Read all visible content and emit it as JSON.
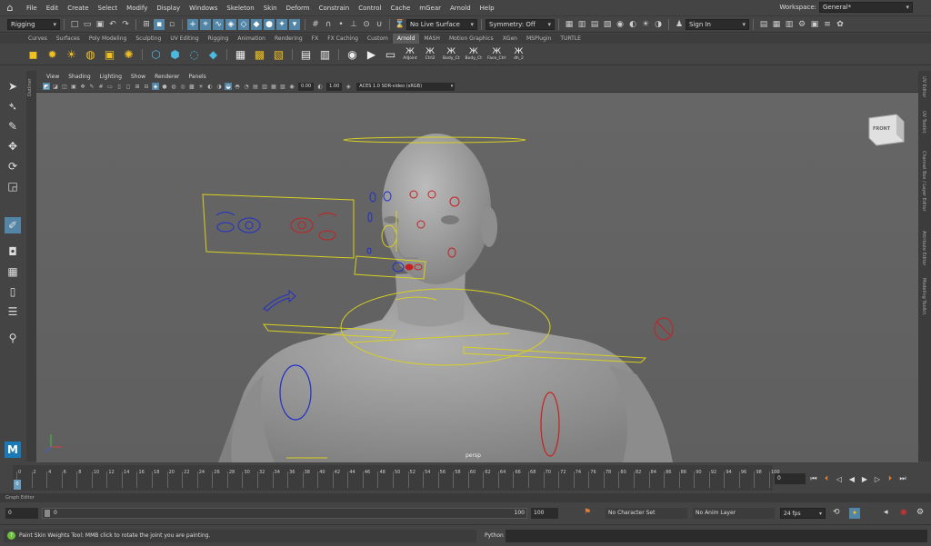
{
  "menubar": {
    "items": [
      "File",
      "Edit",
      "Create",
      "Select",
      "Modify",
      "Display",
      "Windows",
      "Skeleton",
      "Skin",
      "Deform",
      "Constrain",
      "Control",
      "Cache",
      "mGear",
      "Arnold",
      "Help"
    ],
    "workspace_label": "Workspace:",
    "workspace_value": "General*"
  },
  "statusline": {
    "menuset": "Rigging",
    "live_surface": "No Live Surface",
    "symmetry": "Symmetry: Off",
    "sign_in": "Sign In"
  },
  "shelf": {
    "tabs": [
      "Curves",
      "Surfaces",
      "Poly Modeling",
      "Sculpting",
      "UV Editing",
      "Rigging",
      "Animation",
      "Rendering",
      "FX",
      "FX Caching",
      "Custom",
      "Arnold",
      "MASH",
      "Motion Graphics",
      "XGen",
      "MSPlugin",
      "TURTLE"
    ],
    "active_tab": "Arnold",
    "text_buttons": [
      "AllJoint",
      "Ctrl2",
      "Body_Ct",
      "Body_Ct",
      "Face_Ctrl",
      "dh_2"
    ]
  },
  "panel": {
    "menus": [
      "View",
      "Shading",
      "Lighting",
      "Show",
      "Renderer",
      "Panels"
    ],
    "exposure": "0.00",
    "gamma": "1.00",
    "color_space": "ACES 1.0 SDR-video (sRGB)",
    "camera_label": "persp",
    "viewcube_label": "FRONT"
  },
  "side_labels": {
    "outliner": "Outliner",
    "right": [
      "UV Editor",
      "UV Toolkit",
      "Channel Box / Layer Editor",
      "Attribute Editor",
      "Modeling Toolkit"
    ]
  },
  "timeslider": {
    "ticks": [
      "0",
      "2",
      "4",
      "6",
      "8",
      "10",
      "12",
      "14",
      "16",
      "18",
      "20",
      "22",
      "24",
      "26",
      "28",
      "30",
      "32",
      "34",
      "36",
      "38",
      "40",
      "42",
      "44",
      "46",
      "48",
      "50",
      "52",
      "54",
      "56",
      "58",
      "60",
      "62",
      "64",
      "66",
      "68",
      "70",
      "72",
      "74",
      "76",
      "78",
      "80",
      "82",
      "84",
      "86",
      "88",
      "90",
      "92",
      "94",
      "96",
      "98",
      "100"
    ],
    "current_frame": "0",
    "current_frame_marker": "0"
  },
  "graph_editor_label": "Graph Editor",
  "range": {
    "start": "0",
    "inner_start": "0",
    "inner_end": "100",
    "end": "100",
    "character_set": "No Character Set",
    "anim_layer": "No Anim Layer",
    "fps": "24 fps"
  },
  "commandline": {
    "help_text": "Paint Skin Weights Tool: MMB click to rotate the joint you are painting.",
    "language": "Python"
  },
  "colors": {
    "selection": "#5285a6",
    "control_yellow": "#d8d020",
    "control_blue": "#2030c8",
    "control_red": "#c82020"
  }
}
